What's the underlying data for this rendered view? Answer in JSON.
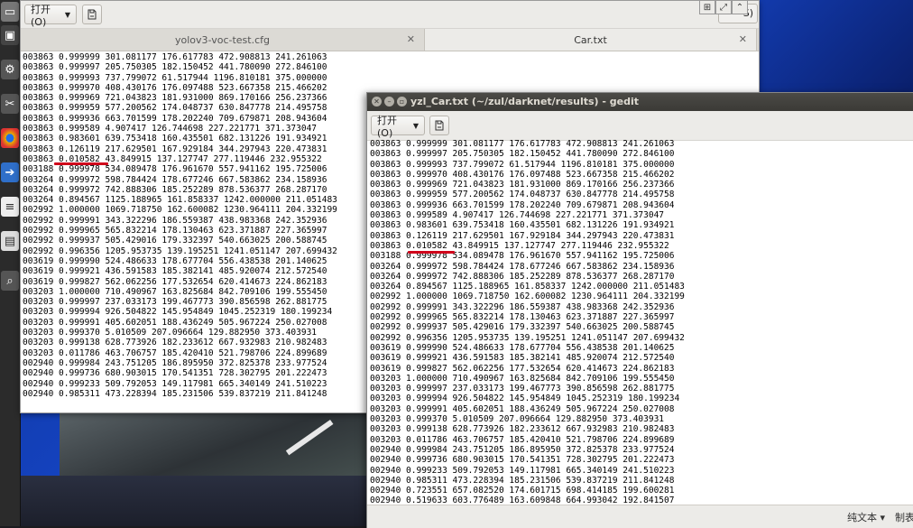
{
  "window_back": {
    "open_label": "打开(O)",
    "tabs": [
      {
        "label": "yolov3-voc-test.cfg"
      },
      {
        "label": "Car.txt"
      }
    ],
    "partial_button_label": "S)",
    "lines": [
      "003863 0.999999 301.081177 176.617783 472.908813 241.261063",
      "003863 0.999997 205.750305 182.150452 441.780090 272.846100",
      "003863 0.999993 737.799072 61.517944 1196.810181 375.000000",
      "003863 0.999970 408.430176 176.097488 523.667358 215.466202",
      "003863 0.999969 721.043823 181.931000 869.170166 256.237366",
      "003863 0.999959 577.200562 174.048737 630.847778 214.495758",
      "003863 0.999936 663.701599 178.202240 709.679871 208.943604",
      "003863 0.999589 4.907417 126.744698 227.221771 371.373047",
      "003863 0.983601 639.753418 160.435501 682.131226 191.934921",
      "003863 0.126119 217.629501 167.929184 344.297943 220.473831",
      "003863 0.010582 43.849915 137.127747 277.119446 232.955322",
      "003188 0.999978 534.089478 176.961670 557.941162 195.725006",
      "003264 0.999972 598.784424 178.677246 667.583862 234.158936",
      "003264 0.999972 742.888306 185.252289 878.536377 268.287170",
      "003264 0.894567 1125.188965 161.858337 1242.000000 211.051483",
      "002992 1.000000 1069.718750 162.600082 1230.964111 204.332199",
      "002992 0.999991 343.322296 186.559387 438.983368 242.352936",
      "002992 0.999965 565.832214 178.130463 623.371887 227.365997",
      "002992 0.999937 505.429016 179.332397 540.663025 200.588745",
      "002992 0.996356 1205.953735 139.195251 1241.051147 207.699432",
      "003619 0.999990 524.486633 178.677704 556.438538 201.140625",
      "003619 0.999921 436.591583 185.382141 485.920074 212.572540",
      "003619 0.999827 562.062256 177.532654 620.414673 224.862183",
      "003203 1.000000 710.490967 163.825684 842.709106 199.555450",
      "003203 0.999997 237.033173 199.467773 390.856598 262.881775",
      "003203 0.999994 926.504822 145.954849 1045.252319 180.199234",
      "003203 0.999991 405.602051 188.436249 505.967224 250.027008",
      "003203 0.999370 5.010509 207.096664 129.882950 373.403931",
      "003203 0.999138 628.773926 182.233612 667.932983 210.982483",
      "003203 0.011786 463.706757 185.420410 521.798706 224.899689",
      "002940 0.999984 243.751205 186.895950 372.825378 233.977524",
      "002940 0.999736 680.903015 170.541351 728.302795 201.222473",
      "002940 0.999233 509.792053 149.117981 665.340149 241.510223",
      "002940 0.985311 473.228394 185.231506 539.837219 211.841248"
    ]
  },
  "window_front": {
    "title": "yzl_Car.txt (~/zul/darknet/results) - gedit",
    "open_label": "打开(O)",
    "lines": [
      "003863 0.999999 301.081177 176.617783 472.908813 241.261063",
      "003863 0.999997 205.750305 182.150452 441.780090 272.846100",
      "003863 0.999993 737.799072 61.517944 1196.810181 375.000000",
      "003863 0.999970 408.430176 176.097488 523.667358 215.466202",
      "003863 0.999969 721.043823 181.931000 869.170166 256.237366",
      "003863 0.999959 577.200562 174.048737 630.847778 214.495758",
      "003863 0.999936 663.701599 178.202240 709.679871 208.943604",
      "003863 0.999589 4.907417 126.744698 227.221771 371.373047",
      "003863 0.983601 639.753418 160.435501 682.131226 191.934921",
      "003863 0.126119 217.629501 167.929184 344.297943 220.473831",
      "003863 0.010582 43.849915 137.127747 277.119446 232.955322",
      "003188 0.999978 534.089478 176.961670 557.941162 195.725006",
      "003264 0.999972 598.784424 178.677246 667.583862 234.158936",
      "003264 0.999972 742.888306 185.252289 878.536377 268.287170",
      "003264 0.894567 1125.188965 161.858337 1242.000000 211.051483",
      "002992 1.000000 1069.718750 162.600082 1230.964111 204.332199",
      "002992 0.999991 343.322296 186.559387 438.983368 242.352936",
      "002992 0.999965 565.832214 178.130463 623.371887 227.365997",
      "002992 0.999937 505.429016 179.332397 540.663025 200.588745",
      "002992 0.996356 1205.953735 139.195251 1241.051147 207.699432",
      "003619 0.999990 524.486633 178.677704 556.438538 201.140625",
      "003619 0.999921 436.591583 185.382141 485.920074 212.572540",
      "003619 0.999827 562.062256 177.532654 620.414673 224.862183",
      "003203 1.000000 710.490967 163.825684 842.709106 199.555450",
      "003203 0.999997 237.033173 199.467773 390.856598 262.881775",
      "003203 0.999994 926.504822 145.954849 1045.252319 180.199234",
      "003203 0.999991 405.602051 188.436249 505.967224 250.027008",
      "003203 0.999370 5.010509 207.096664 129.882950 373.403931",
      "003203 0.999138 628.773926 182.233612 667.932983 210.982483",
      "003203 0.011786 463.706757 185.420410 521.798706 224.899689",
      "002940 0.999984 243.751205 186.895950 372.825378 233.977524",
      "002940 0.999736 680.903015 170.541351 728.302795 201.222473",
      "002940 0.999233 509.792053 149.117981 665.340149 241.510223",
      "002940 0.985311 473.228394 185.231506 539.837219 211.841248",
      "002940 0.723551 657.082520 174.601715 698.414185 199.600281",
      "002940 0.519633 603.776489 163.609848 664.993042 192.841507"
    ],
    "status": {
      "language": "纯文本 ▾",
      "tab_width": "制表"
    }
  },
  "colors": {
    "annotation_underline": "#d0021b",
    "launcher_bg": "#2b2b2b"
  }
}
